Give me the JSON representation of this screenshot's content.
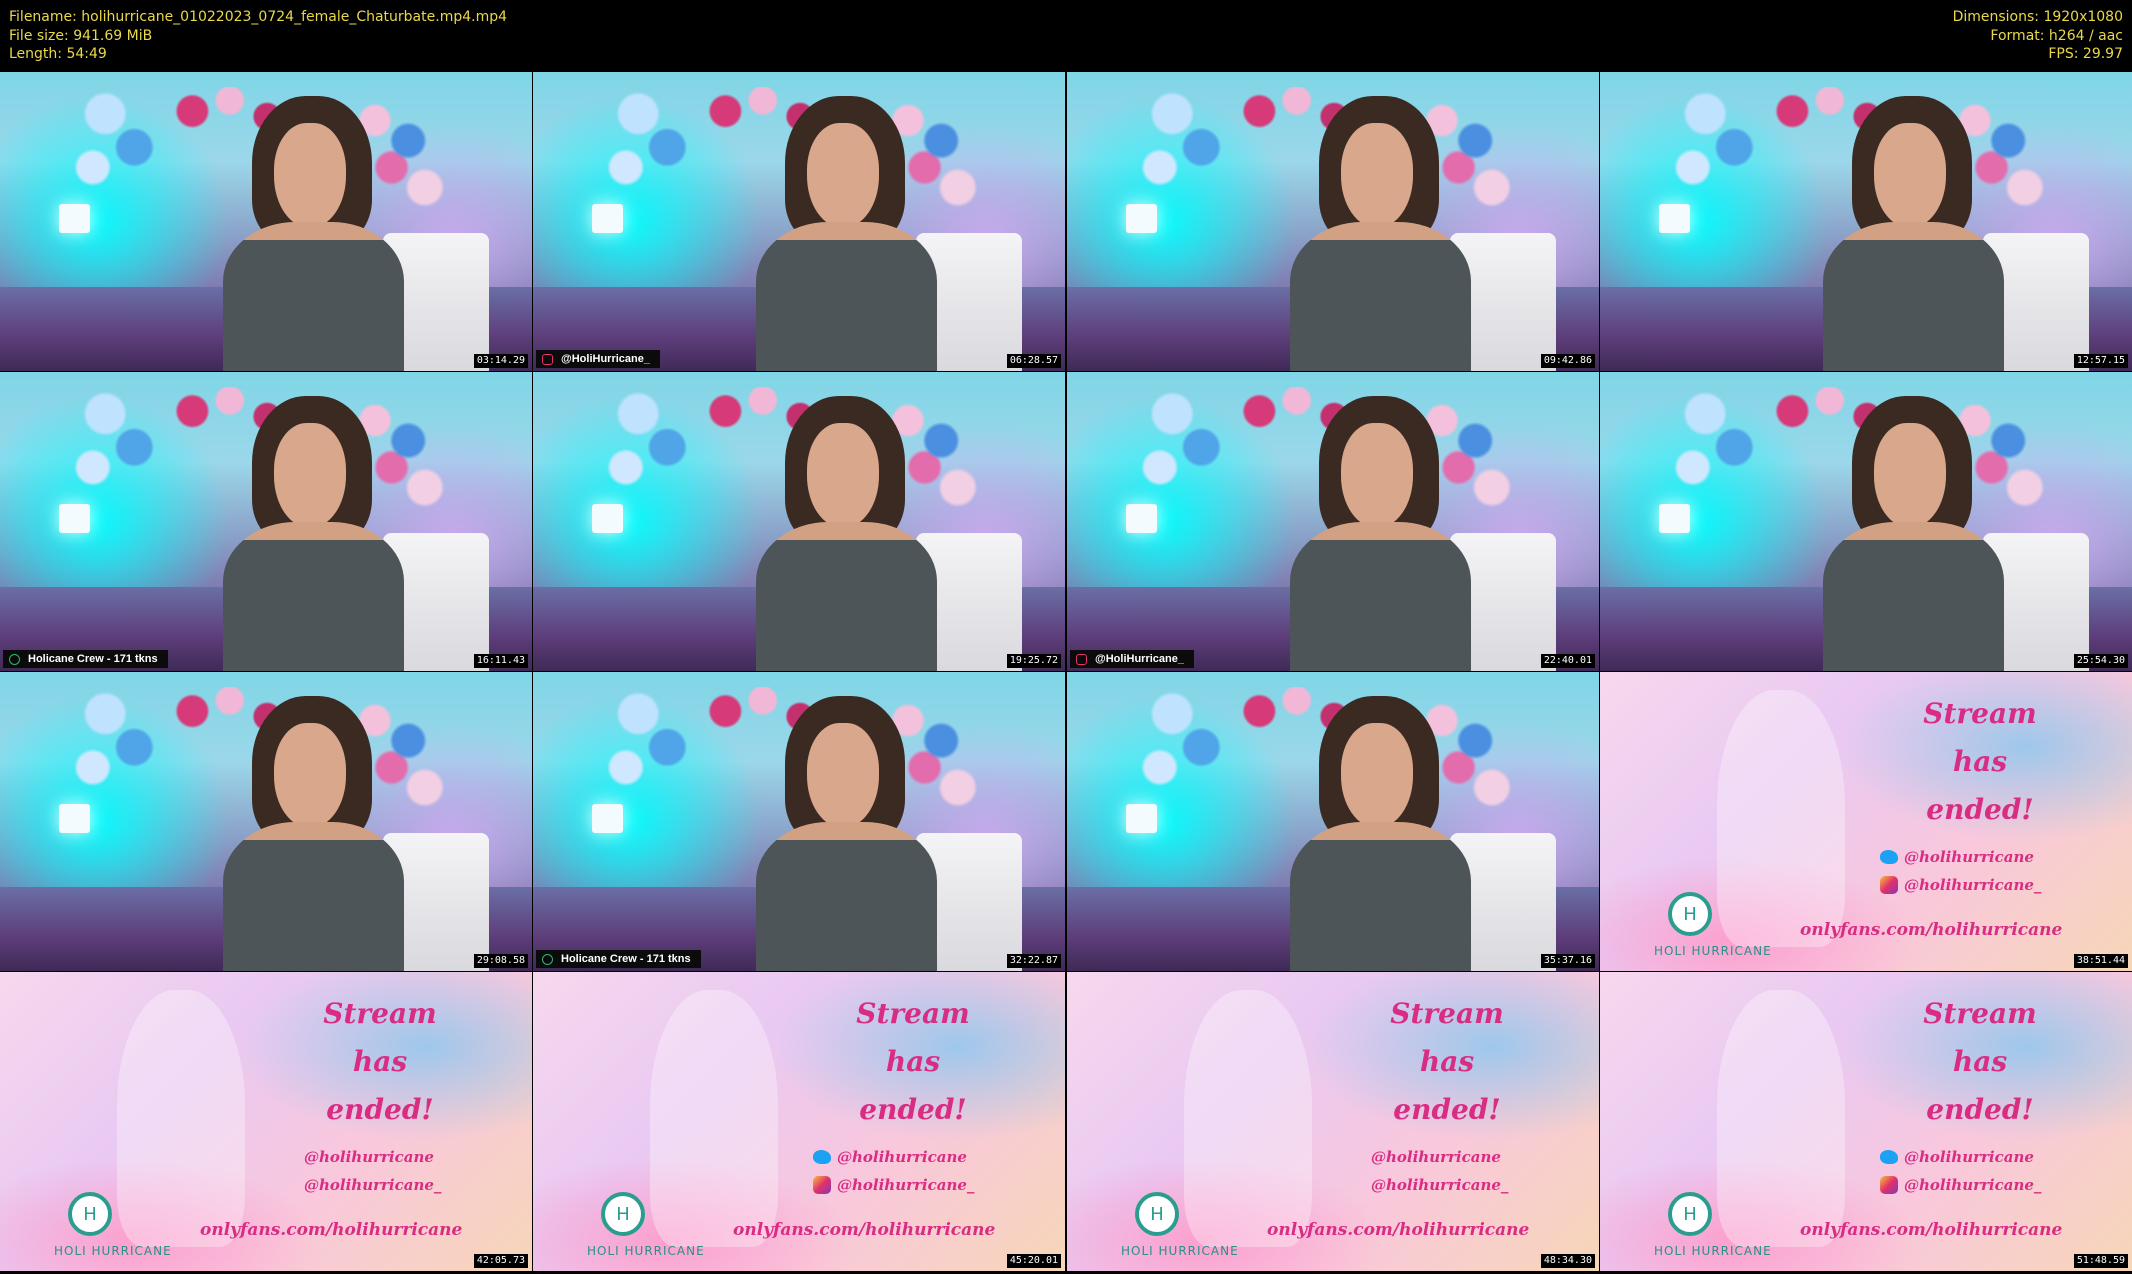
{
  "header": {
    "filename_line": "Filename: holihurricane_01022023_0724_female_Chaturbate.mp4.mp4",
    "filesize_line": "File size: 941.69 MiB",
    "length_line": "Length: 54:49",
    "dimensions_line": "Dimensions: 1920x1080",
    "format_line": "Format: h264 / aac",
    "fps_line": "FPS: 29.97"
  },
  "tiles": [
    {
      "kind": "cam",
      "timestamp": "03:14.29",
      "overlay": ""
    },
    {
      "kind": "cam",
      "timestamp": "06:28.57",
      "overlay": "@HoliHurricane_",
      "overlay_icon": "instagram-icon"
    },
    {
      "kind": "cam",
      "timestamp": "09:42.86",
      "overlay": ""
    },
    {
      "kind": "cam",
      "timestamp": "12:57.15",
      "overlay": ""
    },
    {
      "kind": "cam",
      "timestamp": "16:11.43",
      "overlay": "Holicane Crew - 171 tkns",
      "overlay_icon": "crew-icon"
    },
    {
      "kind": "cam",
      "timestamp": "19:25.72",
      "overlay": ""
    },
    {
      "kind": "cam",
      "timestamp": "22:40.01",
      "overlay": "@HoliHurricane_",
      "overlay_icon": "instagram-icon"
    },
    {
      "kind": "cam",
      "timestamp": "25:54.30",
      "overlay": ""
    },
    {
      "kind": "cam",
      "timestamp": "29:08.58",
      "overlay": ""
    },
    {
      "kind": "cam",
      "timestamp": "32:22.87",
      "overlay": "Holicane Crew - 171 tkns",
      "overlay_icon": "crew-icon"
    },
    {
      "kind": "cam",
      "timestamp": "35:37.16",
      "overlay": ""
    },
    {
      "kind": "ended",
      "timestamp": "38:51.44",
      "show_twitter": true,
      "show_instagram": true
    },
    {
      "kind": "ended",
      "timestamp": "42:05.73",
      "show_twitter": false,
      "show_instagram": false
    },
    {
      "kind": "ended",
      "timestamp": "45:20.01",
      "show_twitter": true,
      "show_instagram": true
    },
    {
      "kind": "ended",
      "timestamp": "48:34.30",
      "show_twitter": false,
      "show_instagram": false
    },
    {
      "kind": "ended",
      "timestamp": "51:48.59",
      "show_twitter": true,
      "show_instagram": true
    }
  ],
  "ended_card": {
    "line1": "Stream",
    "line2": "has",
    "line3": "ended!",
    "twitter_handle": "@holihurricane",
    "instagram_handle": "@holihurricane_",
    "onlyfans_url": "onlyfans.com/holihurricane",
    "logo_letter": "H",
    "brand_name": "HOLI HURRICANE"
  },
  "colors": {
    "header_text": "#e8d84a",
    "ended_pink": "#d92c83",
    "logo_teal": "#2a9d8f"
  }
}
